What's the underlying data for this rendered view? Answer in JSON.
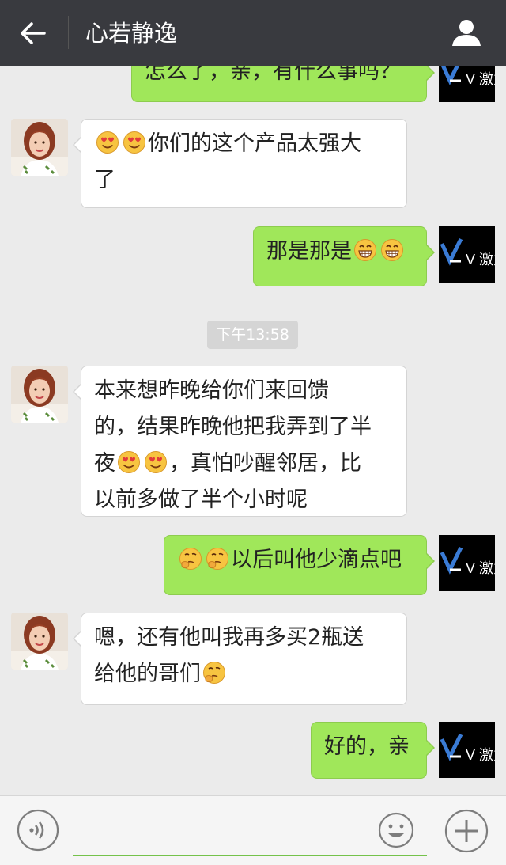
{
  "header": {
    "title": "心若静逸"
  },
  "chat": {
    "messages": [
      {
        "text": "怎么了，亲，有什么事吗？"
      },
      {
        "text_after": "你们的这个产品太强大",
        "line2": "了"
      },
      {
        "text": "那是那是"
      },
      {
        "line1": "本来想昨晚给你们来回馈",
        "line2": "的，结果昨晚他把我弄到了半",
        "line3_a": "夜",
        "line3_b": "，真怕吵醒邻居，比",
        "line4": "以前多做了半个小时呢"
      },
      {
        "text": "以后叫他少滴点吧"
      },
      {
        "line1": "嗯，还有他叫我再多买2瓶送",
        "line2": "给他的哥们"
      },
      {
        "text": "好的，亲"
      }
    ],
    "timestamp": "下午13:58",
    "my_avatar_text": "V 激力"
  },
  "colors": {
    "header": "#393a3f",
    "outgoing": "#a0e75a",
    "incoming": "#ffffff",
    "background": "#ebebeb"
  },
  "icons": [
    "back-arrow-icon",
    "profile-icon",
    "voice-icon",
    "smile-icon",
    "plus-icon",
    "heart-eyes-emoji",
    "grin-emoji",
    "thinking-emoji"
  ]
}
